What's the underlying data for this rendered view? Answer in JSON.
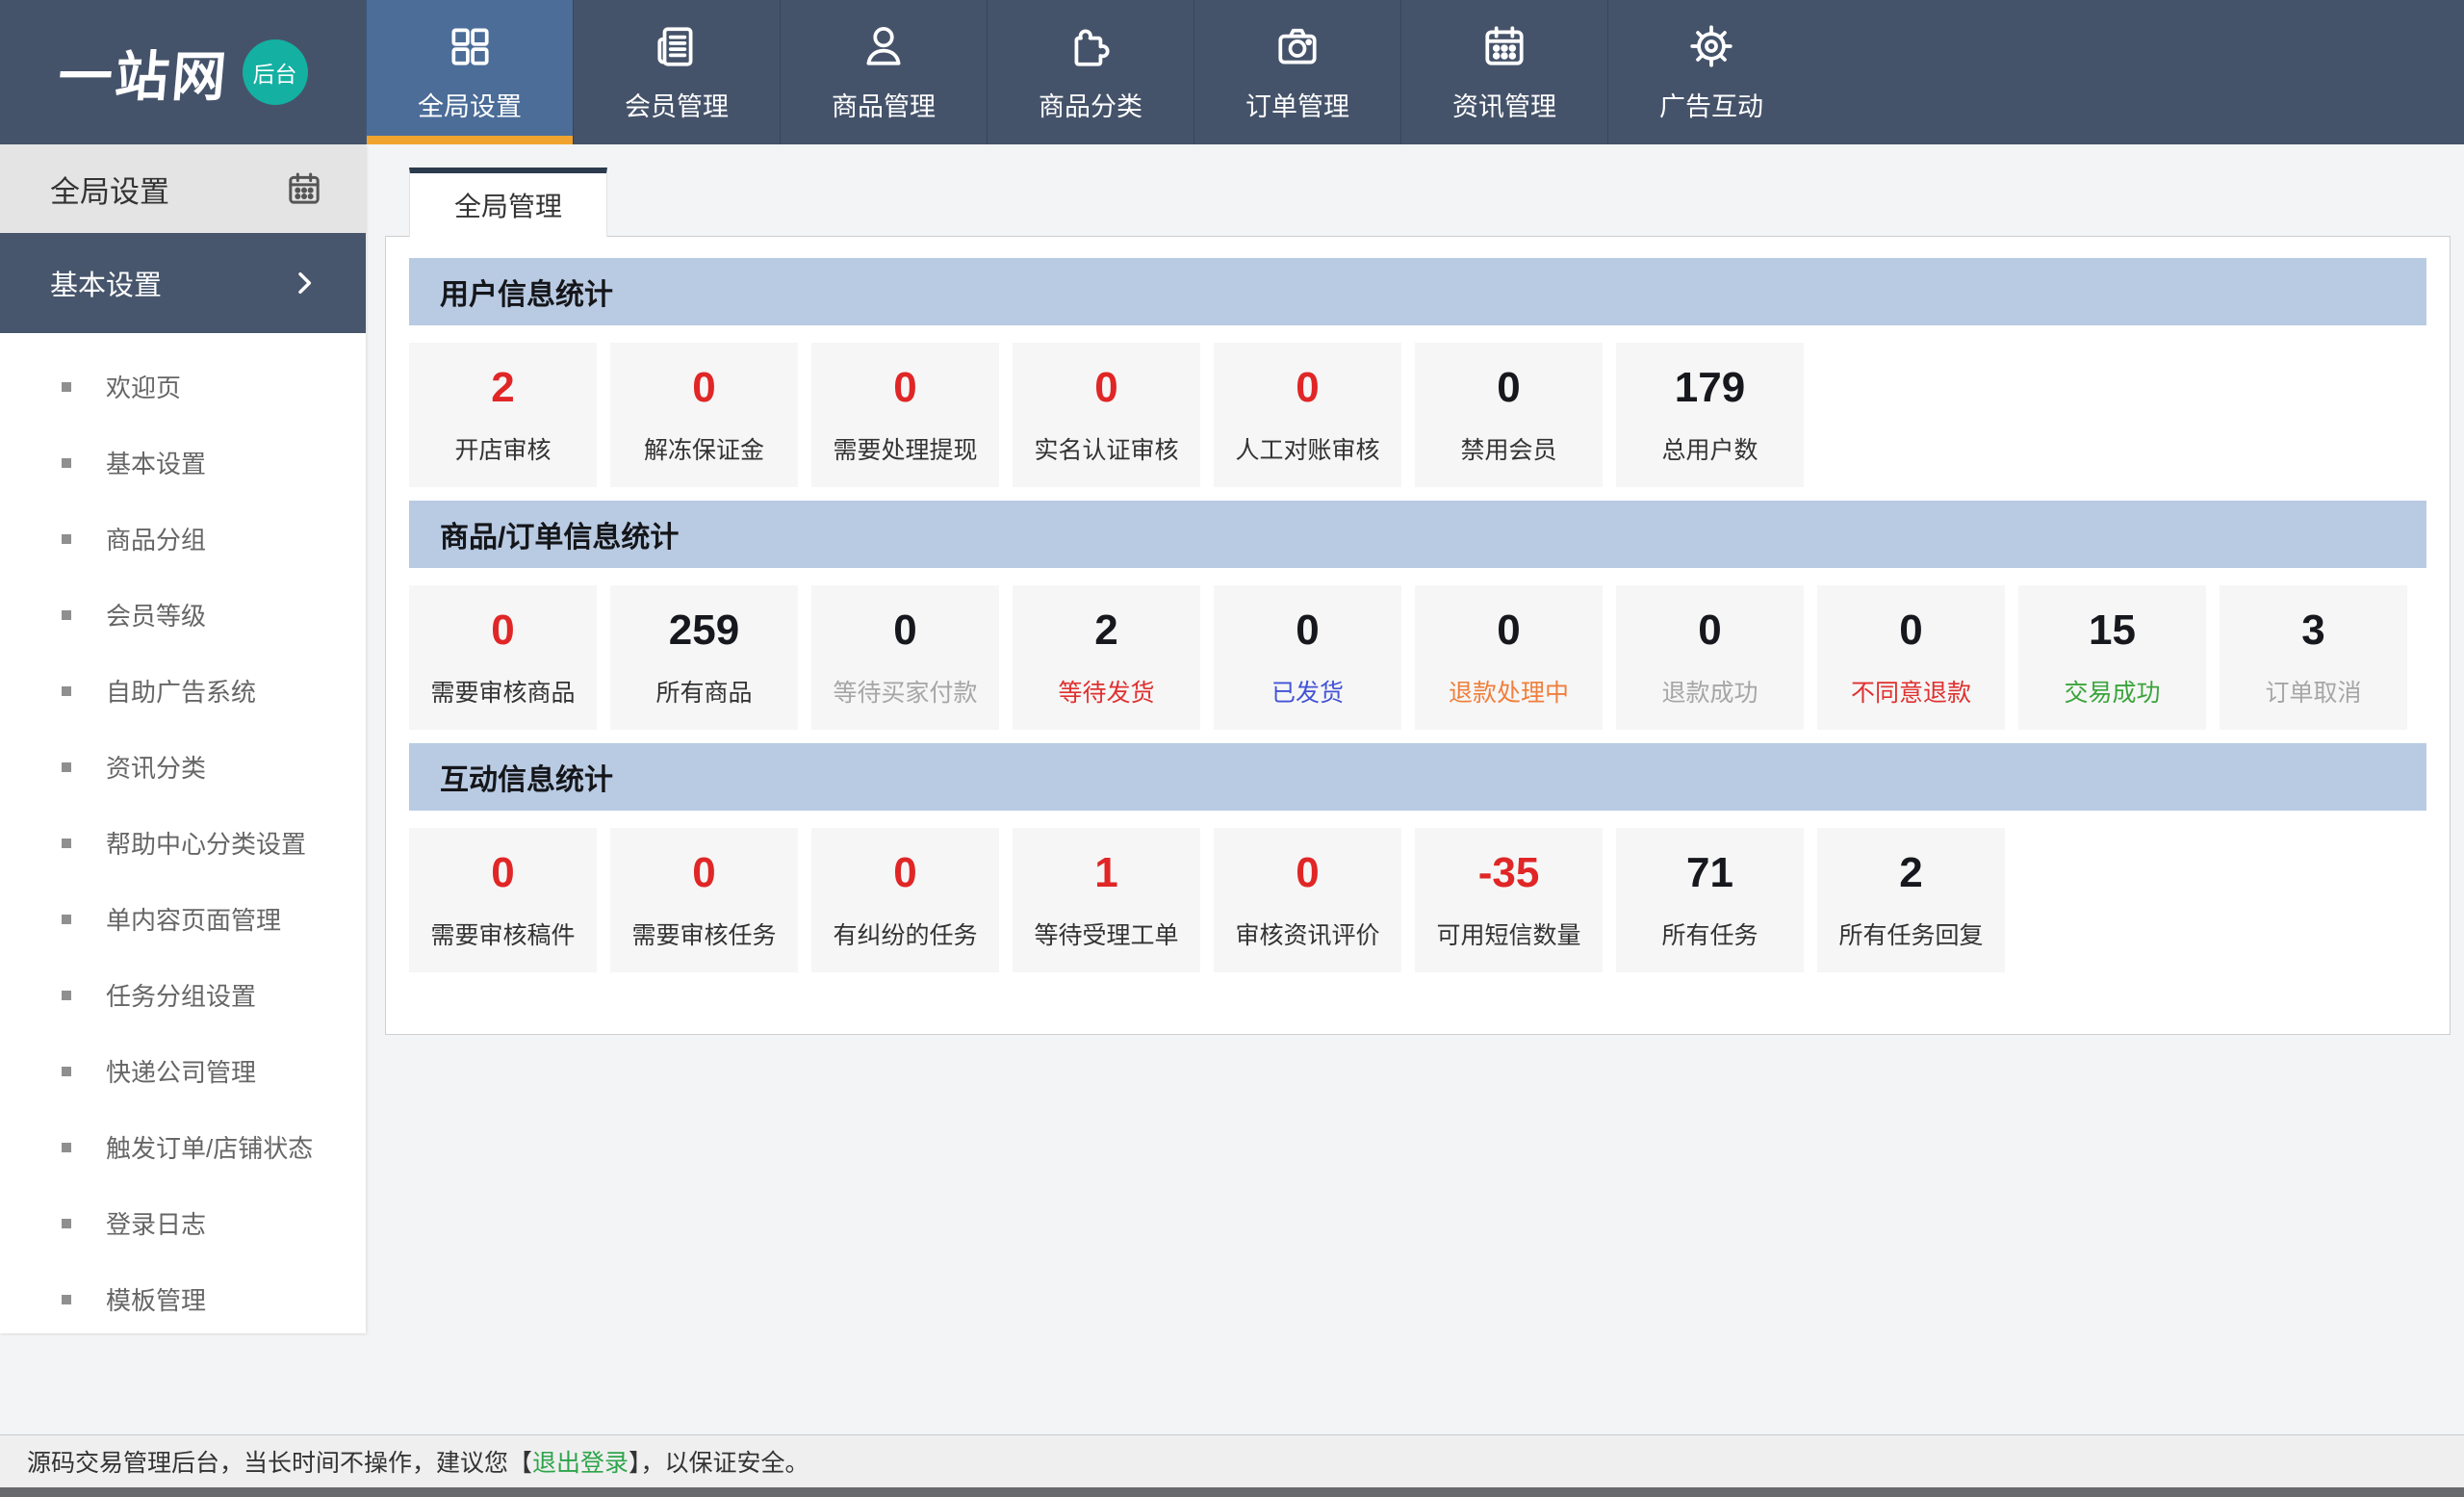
{
  "brand": {
    "logo_text": "一站网",
    "badge_label": "后台"
  },
  "nav": {
    "tabs": [
      {
        "label": "全局设置",
        "icon": "grid-icon",
        "active": true
      },
      {
        "label": "会员管理",
        "icon": "news-icon",
        "active": false
      },
      {
        "label": "商品管理",
        "icon": "user-icon",
        "active": false
      },
      {
        "label": "商品分类",
        "icon": "puzzle-icon",
        "active": false
      },
      {
        "label": "订单管理",
        "icon": "camera-icon",
        "active": false
      },
      {
        "label": "资讯管理",
        "icon": "calendar-icon",
        "active": false
      },
      {
        "label": "广告互动",
        "icon": "gear-icon",
        "active": false
      }
    ]
  },
  "sidebar": {
    "header": {
      "title": "全局设置",
      "icon": "calendar-icon"
    },
    "group": {
      "label": "基本设置",
      "icon": "chevron-right-icon"
    },
    "items": [
      "欢迎页",
      "基本设置",
      "商品分组",
      "会员等级",
      "自助广告系统",
      "资讯分类",
      "帮助中心分类设置",
      "单内容页面管理",
      "任务分组设置",
      "快递公司管理",
      "触发订单/店铺状态",
      "登录日志",
      "模板管理"
    ]
  },
  "main": {
    "tab_label": "全局管理",
    "sections": [
      {
        "title": "用户信息统计",
        "stats": [
          {
            "value": "2",
            "label": "开店审核",
            "value_color": "red",
            "label_color": "dark"
          },
          {
            "value": "0",
            "label": "解冻保证金",
            "value_color": "red",
            "label_color": "dark"
          },
          {
            "value": "0",
            "label": "需要处理提现",
            "value_color": "red",
            "label_color": "dark"
          },
          {
            "value": "0",
            "label": "实名认证审核",
            "value_color": "red",
            "label_color": "dark"
          },
          {
            "value": "0",
            "label": "人工对账审核",
            "value_color": "red",
            "label_color": "dark"
          },
          {
            "value": "0",
            "label": "禁用会员",
            "value_color": "dark",
            "label_color": "dark"
          },
          {
            "value": "179",
            "label": "总用户数",
            "value_color": "dark",
            "label_color": "dark"
          }
        ]
      },
      {
        "title": "商品/订单信息统计",
        "stats": [
          {
            "value": "0",
            "label": "需要审核商品",
            "value_color": "red",
            "label_color": "dark"
          },
          {
            "value": "259",
            "label": "所有商品",
            "value_color": "dark",
            "label_color": "dark"
          },
          {
            "value": "0",
            "label": "等待买家付款",
            "value_color": "dark",
            "label_color": "gray"
          },
          {
            "value": "2",
            "label": "等待发货",
            "value_color": "dark",
            "label_color": "red"
          },
          {
            "value": "0",
            "label": "已发货",
            "value_color": "dark",
            "label_color": "blue"
          },
          {
            "value": "0",
            "label": "退款处理中",
            "value_color": "dark",
            "label_color": "orange"
          },
          {
            "value": "0",
            "label": "退款成功",
            "value_color": "dark",
            "label_color": "gray"
          },
          {
            "value": "0",
            "label": "不同意退款",
            "value_color": "dark",
            "label_color": "red"
          },
          {
            "value": "15",
            "label": "交易成功",
            "value_color": "dark",
            "label_color": "green"
          },
          {
            "value": "3",
            "label": "订单取消",
            "value_color": "dark",
            "label_color": "gray"
          }
        ]
      },
      {
        "title": "互动信息统计",
        "stats": [
          {
            "value": "0",
            "label": "需要审核稿件",
            "value_color": "red",
            "label_color": "dark"
          },
          {
            "value": "0",
            "label": "需要审核任务",
            "value_color": "red",
            "label_color": "dark"
          },
          {
            "value": "0",
            "label": "有纠纷的任务",
            "value_color": "red",
            "label_color": "dark"
          },
          {
            "value": "1",
            "label": "等待受理工单",
            "value_color": "red",
            "label_color": "dark"
          },
          {
            "value": "0",
            "label": "审核资讯评价",
            "value_color": "red",
            "label_color": "dark"
          },
          {
            "value": "-35",
            "label": "可用短信数量",
            "value_color": "red",
            "label_color": "dark"
          },
          {
            "value": "71",
            "label": "所有任务",
            "value_color": "dark",
            "label_color": "dark"
          },
          {
            "value": "2",
            "label": "所有任务回复",
            "value_color": "dark",
            "label_color": "dark"
          }
        ]
      }
    ]
  },
  "footer": {
    "text_before": "源码交易管理后台，当长时间不操作，建议您【",
    "link_label": "退出登录",
    "text_after": "】，以保证安全。"
  },
  "colors": {
    "header_bg": "#45536a",
    "active_tab_bg": "#4b6d98",
    "active_tab_underline": "#f0a32f",
    "brand_badge": "#14b0a2",
    "sidebar_group_bg": "#47566c",
    "section_bar_bg": "#b9cbe3",
    "stat_red": "#e02626",
    "stat_dark": "#17181d",
    "label_dark": "#333333",
    "label_gray": "#a6a6a6",
    "label_red": "#e03030",
    "label_blue": "#4253d6",
    "label_orange": "#f07f3c",
    "label_green": "#3ba43b",
    "footer_link_green": "#2ea44a"
  }
}
